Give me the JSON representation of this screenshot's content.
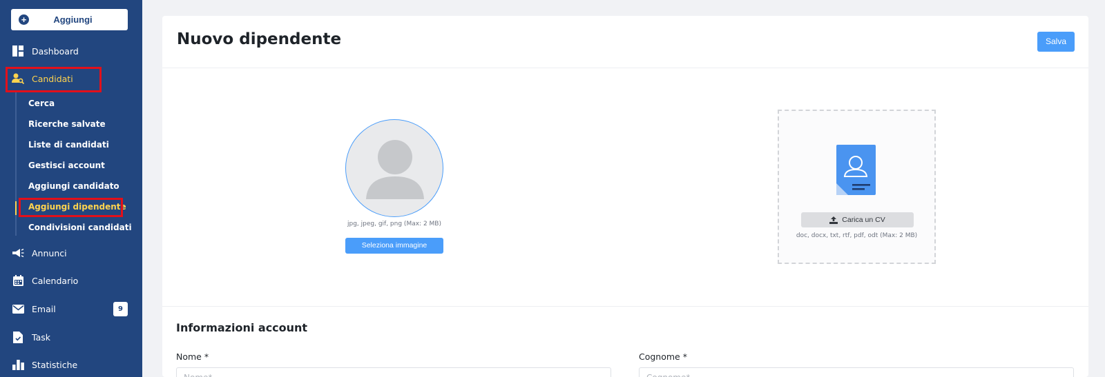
{
  "sidebar": {
    "add_label": "Aggiungi",
    "items": [
      {
        "label": "Dashboard",
        "icon": "dashboard-icon"
      },
      {
        "label": "Candidati",
        "icon": "user-search-icon"
      },
      {
        "label": "Annunci",
        "icon": "megaphone-icon"
      },
      {
        "label": "Calendario",
        "icon": "calendar-icon"
      },
      {
        "label": "Email",
        "icon": "mail-icon",
        "badge": "9"
      },
      {
        "label": "Task",
        "icon": "task-icon"
      },
      {
        "label": "Statistiche",
        "icon": "bar-chart-icon"
      }
    ],
    "candidati_sub": [
      "Cerca",
      "Ricerche salvate",
      "Liste di candidati",
      "Gestisci account",
      "Aggiungi candidato",
      "Aggiungi dipendente",
      "Condivisioni candidati"
    ]
  },
  "page": {
    "title": "Nuovo dipendente",
    "save_label": "Salva"
  },
  "photo": {
    "hint": "jpg, jpeg, gif, png (Max: 2 MB)",
    "select_label": "Seleziona immagine"
  },
  "cv": {
    "upload_label": "Carica un CV",
    "hint": "doc, docx, txt, rtf, pdf, odt (Max: 2 MB)"
  },
  "account": {
    "title": "Informazioni account",
    "nome_label": "Nome *",
    "nome_placeholder": "Nome*",
    "cognome_label": "Cognome *",
    "cognome_placeholder": "Cognome*"
  },
  "colors": {
    "sidebar_bg": "#22467f",
    "accent": "#4a9dfa",
    "active": "#ffd34e",
    "highlight": "#e3101a"
  }
}
